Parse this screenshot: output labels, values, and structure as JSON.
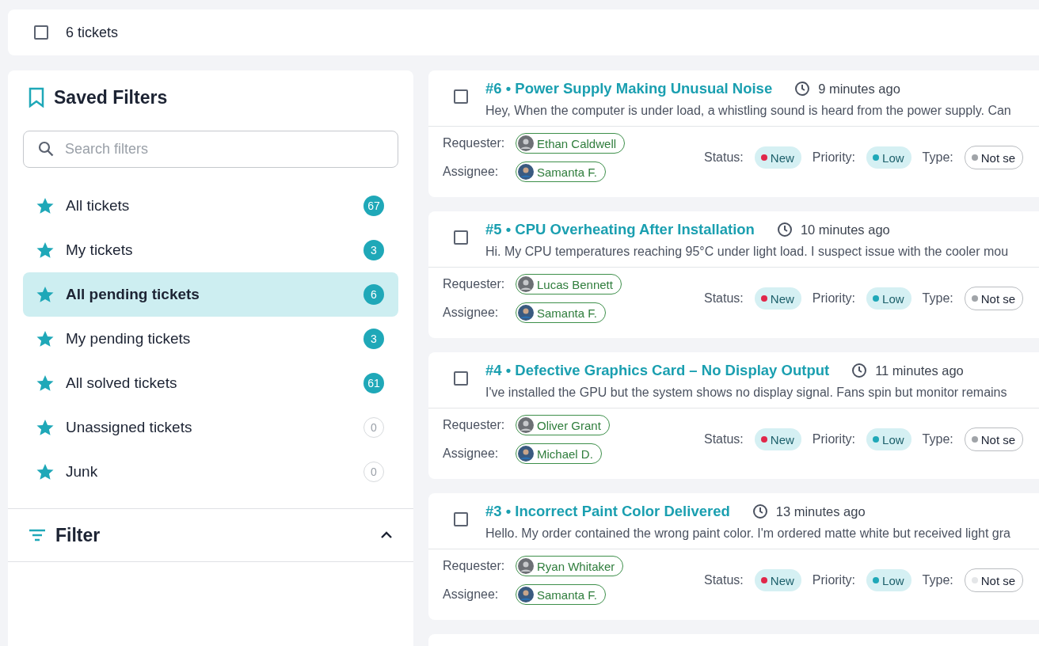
{
  "header": {
    "select_all": {
      "checked": false
    },
    "count": "6 tickets"
  },
  "sidebar": {
    "title": "Saved Filters",
    "search": {
      "placeholder": "Search filters"
    },
    "items": [
      {
        "label": "All tickets",
        "count": "67",
        "filled": true,
        "selected": false
      },
      {
        "label": "My tickets",
        "count": "3",
        "filled": true,
        "selected": false
      },
      {
        "label": "All pending tickets",
        "count": "6",
        "filled": true,
        "selected": true
      },
      {
        "label": "My pending tickets",
        "count": "3",
        "filled": true,
        "selected": false
      },
      {
        "label": "All solved tickets",
        "count": "61",
        "filled": true,
        "selected": false
      },
      {
        "label": "Unassigned tickets",
        "count": "0",
        "filled": false,
        "selected": false
      },
      {
        "label": "Junk",
        "count": "0",
        "filled": false,
        "selected": false
      }
    ],
    "filter": {
      "title": "Filter",
      "expanded": true
    }
  },
  "tickets": [
    {
      "checked": false,
      "number": "#6",
      "separator": "•",
      "title": "Power Supply Making Unusual Noise",
      "time": "9 minutes ago",
      "preview": "Hey,  When the computer is under load, a whistling sound is heard from the power supply. Can",
      "requester_label": "Requester:",
      "requester": "Ethan Caldwell",
      "assignee_label": "Assignee:",
      "assignee": "Samanta F.",
      "status_label": "Status:",
      "status": {
        "text": "New",
        "color": "#e0284a"
      },
      "priority_label": "Priority:",
      "priority": {
        "text": "Low",
        "color": "#1fa8b8"
      },
      "type_label": "Type:",
      "type": {
        "text": "Not se",
        "color": "#a0a4a8"
      }
    },
    {
      "checked": false,
      "number": "#5",
      "separator": "•",
      "title": "CPU Overheating After Installation",
      "time": "10 minutes ago",
      "preview": "Hi. My CPU temperatures reaching 95°C under light load. I suspect issue with the cooler mou",
      "requester_label": "Requester:",
      "requester": "Lucas Bennett",
      "assignee_label": "Assignee:",
      "assignee": "Samanta F.",
      "status_label": "Status:",
      "status": {
        "text": "New",
        "color": "#e0284a"
      },
      "priority_label": "Priority:",
      "priority": {
        "text": "Low",
        "color": "#1fa8b8"
      },
      "type_label": "Type:",
      "type": {
        "text": "Not se",
        "color": "#a0a4a8"
      }
    },
    {
      "checked": false,
      "number": "#4",
      "separator": "•",
      "title": "Defective Graphics Card – No Display Output",
      "time": "11 minutes ago",
      "preview": "I've installed the GPU but the system shows no display signal. Fans spin but monitor remains",
      "requester_label": "Requester:",
      "requester": "Oliver Grant",
      "assignee_label": "Assignee:",
      "assignee": "Michael D.",
      "status_label": "Status:",
      "status": {
        "text": "New",
        "color": "#e0284a"
      },
      "priority_label": "Priority:",
      "priority": {
        "text": "Low",
        "color": "#1fa8b8"
      },
      "type_label": "Type:",
      "type": {
        "text": "Not se",
        "color": "#a0a4a8"
      }
    },
    {
      "checked": false,
      "number": "#3",
      "separator": "•",
      "title": "Incorrect Paint Color Delivered",
      "time": "13 minutes ago",
      "preview": "Hello. My order contained the wrong paint color. I'm ordered matte white but received light gra",
      "requester_label": "Requester:",
      "requester": "Ryan Whitaker",
      "assignee_label": "Assignee:",
      "assignee": "Samanta F.",
      "status_label": "Status:",
      "status": {
        "text": "New",
        "color": "#e0284a"
      },
      "priority_label": "Priority:",
      "priority": {
        "text": "Low",
        "color": "#1fa8b8"
      },
      "type_label": "Type:",
      "type": {
        "text": "Not se",
        "color": "#e4e6e8"
      }
    }
  ]
}
